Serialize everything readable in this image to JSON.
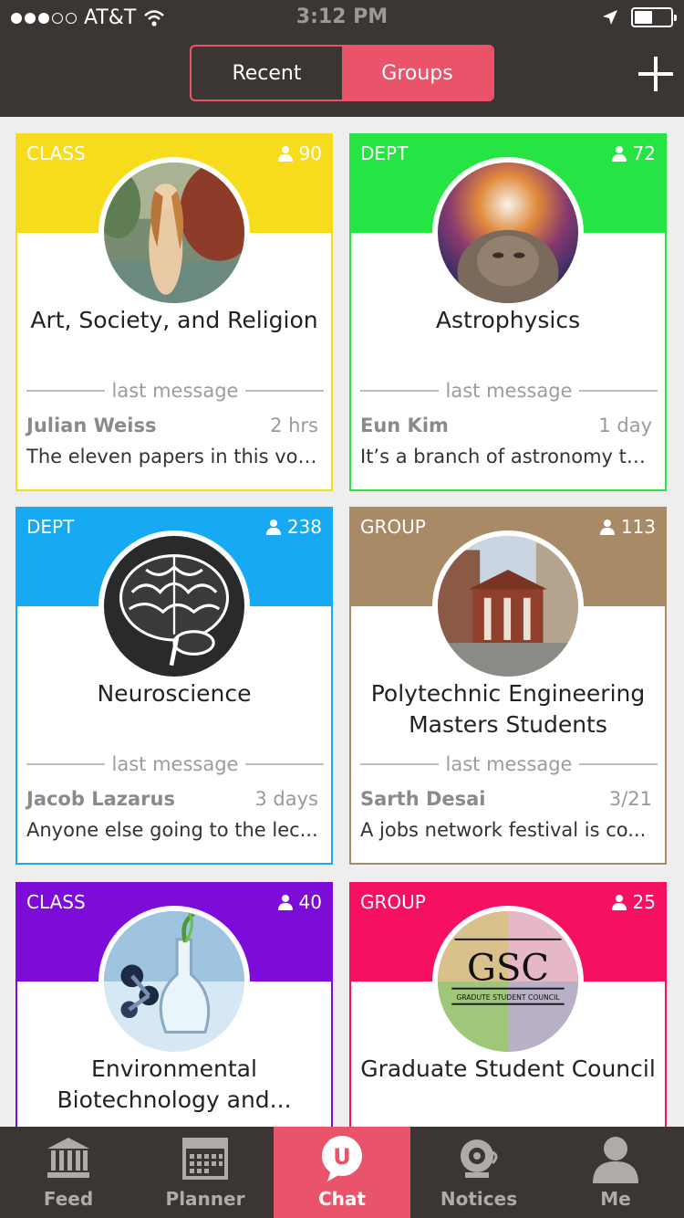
{
  "status_bar": {
    "carrier": "AT&T",
    "time": "3:12 PM"
  },
  "segmented": {
    "recent_label": "Recent",
    "groups_label": "Groups",
    "selected": "Groups"
  },
  "colors": {
    "header_bg": "#3b3634",
    "accent": "#e9546b",
    "class_yellow": "#f6dc1b",
    "dept_green": "#27e445",
    "dept_blue": "#17aaf2",
    "group_brown": "#a88a66",
    "class_purple": "#7d0cd8",
    "group_pink": "#f51062"
  },
  "cards": [
    {
      "type": "CLASS",
      "members": "90",
      "title": "Art, Society, and Religion",
      "divider": "last message",
      "sender": "Julian Weiss",
      "time": "2 hrs",
      "preview": "The eleven papers in this vol..."
    },
    {
      "type": "DEPT",
      "members": "72",
      "title": "Astrophysics",
      "divider": "last message",
      "sender": "Eun Kim",
      "time": "1 day",
      "preview": "It’s a branch of astronomy th..."
    },
    {
      "type": "DEPT",
      "members": "238",
      "title": "Neuroscience",
      "divider": "last message",
      "sender": "Jacob Lazarus",
      "time": "3 days",
      "preview": "Anyone else going to the lec..."
    },
    {
      "type": "GROUP",
      "members": "113",
      "title": "Polytechnic Engineering Masters Students",
      "divider": "last message",
      "sender": "Sarth Desai",
      "time": "3/21",
      "preview": "A jobs network festival is co..."
    },
    {
      "type": "CLASS",
      "members": "40",
      "title": "Environmental Biotechnology and...",
      "divider": "",
      "sender": "",
      "time": "",
      "preview": ""
    },
    {
      "type": "GROUP",
      "members": "25",
      "title": "Graduate Student Council",
      "divider": "",
      "sender": "",
      "time": "",
      "preview": ""
    }
  ],
  "gsc_logo": {
    "abbr": "GSC",
    "full": "GRADUTE STUDENT COUNCIL"
  },
  "tabbar": {
    "items": [
      {
        "label": "Feed",
        "icon": "bank-icon"
      },
      {
        "label": "Planner",
        "icon": "calendar-icon"
      },
      {
        "label": "Chat",
        "icon": "chat-bubble-icon",
        "badge": "U"
      },
      {
        "label": "Notices",
        "icon": "alarm-bell-icon"
      },
      {
        "label": "Me",
        "icon": "person-icon"
      }
    ],
    "active": "Chat"
  }
}
